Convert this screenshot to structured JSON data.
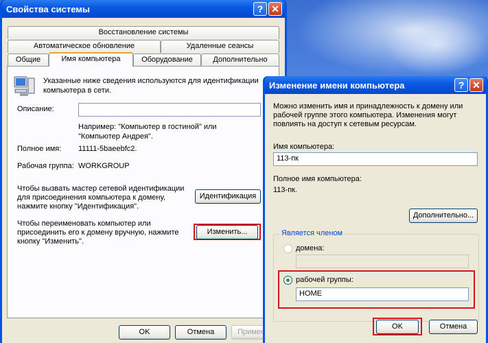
{
  "desktop": {},
  "system_properties": {
    "title": "Свойства системы",
    "tabs_row1": [
      "Восстановление системы"
    ],
    "tabs_row2": [
      "Автоматическое обновление",
      "Удаленные сеансы"
    ],
    "tabs_row3": [
      "Общие",
      "Имя компьютера",
      "Оборудование",
      "Дополнительно"
    ],
    "active_tab": "Имя компьютера",
    "intro": "Указанные ниже сведения используются для идентификации компьютера в сети.",
    "description_label": "Описание:",
    "description_value": "",
    "example": "Например: \"Компьютер в гостиной\" или \"Компьютер Андрея\".",
    "full_name_label": "Полное имя:",
    "full_name_value": "11111-5baeebfc2.",
    "workgroup_label": "Рабочая группа:",
    "workgroup_value": "WORKGROUP",
    "wizard_text": "Чтобы вызвать мастер сетевой идентификации для присоединения компьютера к домену, нажмите кнопку \"Идентификация\".",
    "identify_button": "Идентификация",
    "rename_text": "Чтобы переименовать компьютер или присоединить его к домену вручную, нажмите кнопку \"Изменить\".",
    "change_button": "Изменить...",
    "ok_button": "OK",
    "cancel_button": "Отмена",
    "apply_button": "Применить"
  },
  "rename_dialog": {
    "title": "Изменение имени компьютера",
    "intro": "Можно изменить имя и принадлежность к домену или рабочей группе этого компьютера. Изменения могут повлиять на доступ к сетевым ресурсам.",
    "computer_name_label": "Имя компьютера:",
    "computer_name_value": "113-пк",
    "full_name_label": "Полное имя компьютера:",
    "full_name_value": "113-пк.",
    "more_button": "Дополнительно...",
    "member_group_title": "Является членом",
    "domain_label": "домена:",
    "domain_value": "",
    "workgroup_label": "рабочей группы:",
    "workgroup_value": "HOME",
    "ok_button": "OK",
    "cancel_button": "Отмена",
    "selected_membership": "рабочей группы"
  },
  "colors": {
    "titlebar": "#0054e3",
    "highlight": "#d0171f",
    "dialog_bg": "#ece9d8"
  }
}
